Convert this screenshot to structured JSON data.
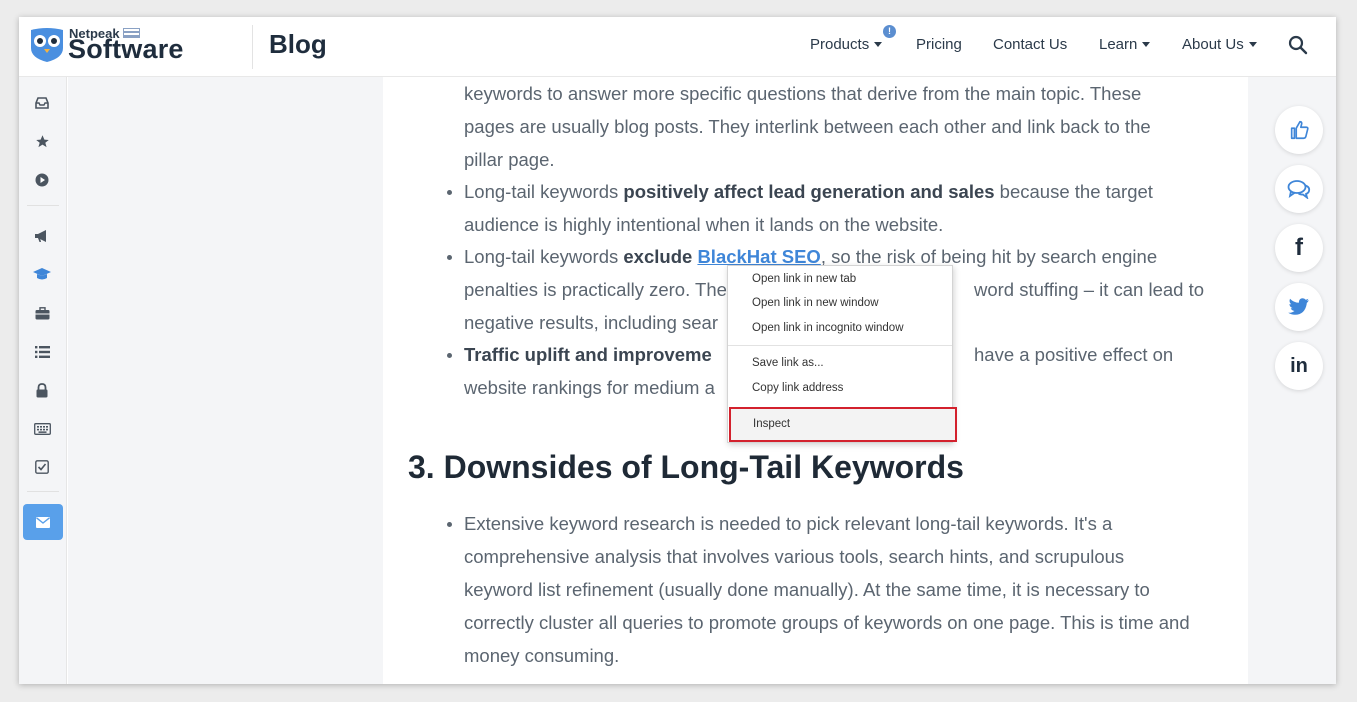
{
  "header": {
    "brand_small": "Netpeak",
    "brand_big": "Software",
    "section_title": "Blog",
    "nav": [
      {
        "label": "Products",
        "has_caret": true
      },
      {
        "label": "Pricing",
        "has_caret": false
      },
      {
        "label": "Contact Us",
        "has_caret": false
      },
      {
        "label": "Learn",
        "has_caret": true
      },
      {
        "label": "About Us",
        "has_caret": true
      }
    ],
    "products_badge": "!"
  },
  "sidebar": {
    "icons": [
      "inbox-icon",
      "star-icon",
      "play-circle-icon",
      "megaphone-icon",
      "graduation-cap-icon",
      "briefcase-icon",
      "list-icon",
      "lock-icon",
      "keyboard-icon",
      "checkbox-icon",
      "mail-icon"
    ],
    "active_color": "#59a0ea"
  },
  "article": {
    "pillar_lines": [
      "keywords to answer more specific questions that derive from the main topic. These",
      "pages are usually blog posts. They interlink between each other and link back to the",
      "pillar page."
    ],
    "b1_pre": "Long-tail keywords ",
    "b1_bold": "positively affect lead generation and sales",
    "b1_post": " because the target",
    "b1_line2": "audience is highly intentional when it lands on the website.",
    "b2_pre": "Long-tail keywords ",
    "b2_bold": "exclude",
    "b2_link": "BlackHat SEO",
    "b2_post": ", so the risk of being hit by search engine",
    "b2_line2_a": "penalties is practically zero. The",
    "b2_line2_b": "word stuffing – it can lead to",
    "b2_line3": "negative results, including sear",
    "b3_bold": "Traffic uplift and improveme",
    "b3_post": "have a positive effect on",
    "b3_line2": "website rankings for medium a",
    "heading": "3. Downsides of Long-Tail Keywords",
    "downside_lines": [
      "Extensive keyword research is needed to pick relevant long-tail keywords. It's a",
      "comprehensive analysis that involves various tools, search hints, and scrupulous",
      "keyword list refinement (usually done manually). At the same time, it is necessary to",
      "correctly cluster all queries to promote groups of keywords on one page. This is time and",
      "money consuming."
    ]
  },
  "context_menu": {
    "items": [
      "Open link in new tab",
      "Open link in new window",
      "Open link in incognito window",
      "Save link as...",
      "Copy link address",
      "Inspect"
    ],
    "highlight_color": "#d3212d"
  },
  "share": {
    "icons": [
      "thumbs-up-icon",
      "comments-icon",
      "facebook-icon",
      "twitter-icon",
      "linkedin-icon"
    ],
    "facebook_label": "f",
    "linkedin_label": "in"
  }
}
